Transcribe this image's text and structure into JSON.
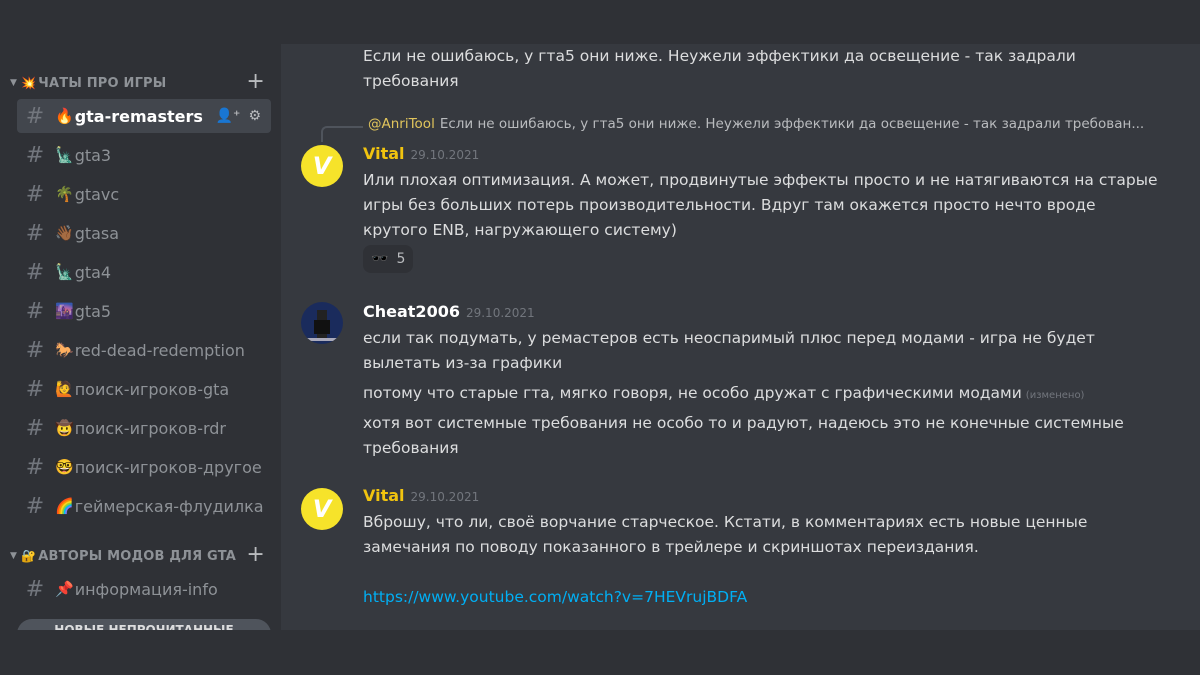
{
  "sidebar": {
    "categories": [
      {
        "label": "ЧАТЫ ПРО ИГРЫ",
        "emoji": "💥"
      },
      {
        "label": "АВТОРЫ МОДОВ ДЛЯ GTA",
        "emoji": "🔐"
      }
    ],
    "channels": [
      {
        "name": "gta-remasters",
        "emoji": "🔥",
        "active": true
      },
      {
        "name": "gta3",
        "emoji": "🗽"
      },
      {
        "name": "gtavc",
        "emoji": "🌴"
      },
      {
        "name": "gtasa",
        "emoji": "👋🏾"
      },
      {
        "name": "gta4",
        "emoji": "🗽"
      },
      {
        "name": "gta5",
        "emoji": "🌆"
      },
      {
        "name": "red-dead-redemption",
        "emoji": "🐎"
      },
      {
        "name": "поиск-игроков-gta",
        "emoji": "🙋"
      },
      {
        "name": "поиск-игроков-rdr",
        "emoji": "🤠"
      },
      {
        "name": "поиск-игроков-другое",
        "emoji": "🤓"
      },
      {
        "name": "геймерская-флудилка",
        "emoji": "🌈"
      },
      {
        "name": "информация-info",
        "emoji": "📌"
      }
    ],
    "unread_pill": "НОВЫЕ НЕПРОЧИТАННЫЕ"
  },
  "messages": {
    "top_text": "Если не ошибаюсь, у гта5 они ниже. Неужели эффектики да освещение - так задрали требования",
    "reply": {
      "author": "@AnriTool",
      "text": "Если не ошибаюсь, у гта5 они ниже. Неужели эффектики да освещение - так задрали требован..."
    },
    "msg1": {
      "author": "Vital",
      "author_color": "#f1c40f",
      "timestamp": "29.10.2021",
      "text": "Или плохая оптимизация. А может, продвинутые эффекты просто и не натягиваются на старые игры без больших потерь производительности. Вдруг там окажется просто нечто вроде крутого ENB, нагружающего систему)",
      "reaction_emoji": "🕶️",
      "reaction_count": "5"
    },
    "msg2": {
      "author": "Cheat2006",
      "author_color": "#ffffff",
      "timestamp": "29.10.2021",
      "line1": "если так подумать, у ремастеров есть неоспаримый плюс перед модами - игра не будет вылетать из-за графики",
      "line2": "потому что старые гта, мягко говоря, не особо дружат с графическими модами",
      "edited": "(изменено)",
      "line3": "хотя вот системные требования не особо то и радуют, надеюсь это не конечные системные требования"
    },
    "msg3": {
      "author": "Vital",
      "author_color": "#f1c40f",
      "timestamp": "29.10.2021",
      "text": "Вброшу, что ли, своё ворчание старческое. Кстати, в комментариях есть новые ценные замечания по поводу показанного в трейлере и скриншотах переиздания.",
      "link": "https://www.youtube.com/watch?v=7HEVrujBDFA"
    }
  },
  "colors": {
    "link": "#00aff4",
    "background": "#36393f",
    "sidebar": "#2f3136"
  }
}
